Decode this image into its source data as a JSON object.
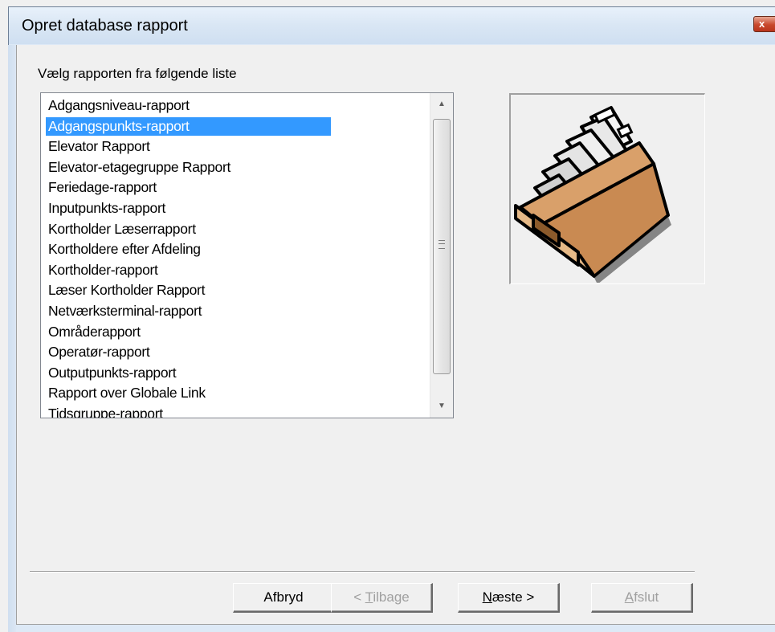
{
  "window": {
    "title": "Opret database rapport",
    "close_glyph": "x"
  },
  "report_list": {
    "label": "Vælg rapporten fra følgende liste",
    "items": [
      "Adgangsniveau-rapport",
      "Adgangspunkts-rapport",
      "Elevator Rapport",
      "Elevator-etagegruppe Rapport",
      "Feriedage-rapport",
      "Inputpunkts-rapport",
      "Kortholder Læserrapport",
      "Kortholdere efter Afdeling",
      "Kortholder-rapport",
      "Læser Kortholder Rapport",
      "Netværksterminal-rapport",
      "Områderapport",
      "Operatør-rapport",
      "Outputpunkts-rapport",
      "Rapport over Globale Link",
      "Tidsgruppe-rapport"
    ],
    "selected_index": 1,
    "selection_color": "#3399ff"
  },
  "illustration": {
    "icon": "card-file-box-icon"
  },
  "buttons": {
    "cancel": {
      "pre": "Afbryd",
      "acc": "",
      "post": "",
      "enabled": true
    },
    "back": {
      "pre": "< ",
      "acc": "T",
      "post": "ilbage",
      "enabled": false
    },
    "next": {
      "pre": "",
      "acc": "N",
      "post": "æste >",
      "enabled": true
    },
    "finish": {
      "pre": "",
      "acc": "A",
      "post": "fslut",
      "enabled": false
    }
  }
}
